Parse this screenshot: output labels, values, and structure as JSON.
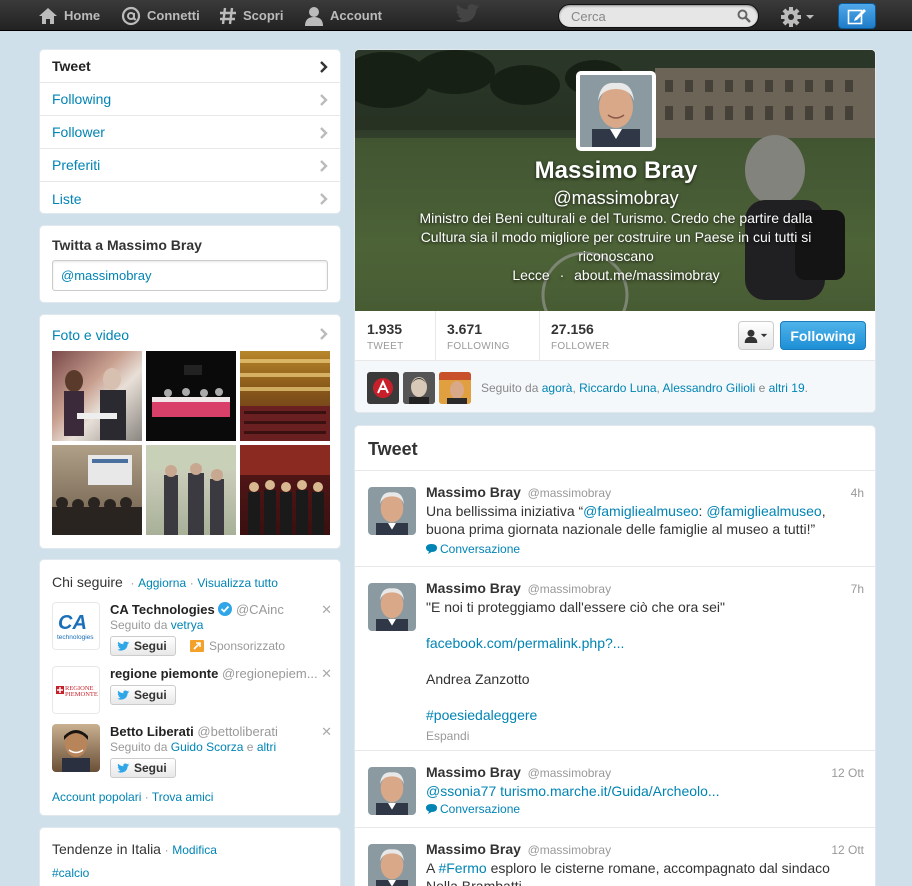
{
  "nav": {
    "home": "Home",
    "connect": "Connetti",
    "discover": "Scopri",
    "account": "Account",
    "search_placeholder": "Cerca"
  },
  "menu": {
    "items": [
      {
        "label": "Tweet"
      },
      {
        "label": "Following"
      },
      {
        "label": "Follower"
      },
      {
        "label": "Preferiti"
      },
      {
        "label": "Liste"
      }
    ]
  },
  "tweet_to": {
    "title": "Twitta a Massimo Bray",
    "value": "@massimobray"
  },
  "photos": {
    "title": "Foto e video"
  },
  "who_to_follow": {
    "title": "Chi seguire",
    "sep1": "·",
    "refresh": "Aggiorna",
    "sep2": "·",
    "view_all": "Visualizza tutto",
    "follow_label": "Segui",
    "users": [
      {
        "name": "CA Technologies",
        "handle": "@CAinc",
        "sub_prefix": "Seguito da",
        "sub_link": "vetrya",
        "sub_suffix": "",
        "promoted": "Sponsorizzato"
      },
      {
        "name": "regione piemonte",
        "handle": "@regionepiem...",
        "sub_prefix": "",
        "sub_link": "",
        "sub_suffix": "",
        "promoted": ""
      },
      {
        "name": "Betto Liberati",
        "handle": "@bettoliberati",
        "sub_prefix": "Seguito da",
        "sub_link": "Guido Scorza",
        "sub_mid": "e",
        "sub_suffix": "altri",
        "promoted": ""
      }
    ],
    "ca_logo_text": "technologies",
    "rp_logo_text1": "REGIONE",
    "rp_logo_text2": "PIEMONTE",
    "popular": "Account popolari",
    "sep3": "·",
    "find_friends": "Trova amici"
  },
  "trends": {
    "title": "Tendenze in Italia",
    "sep": "·",
    "change": "Modifica",
    "items": [
      "#calcio"
    ]
  },
  "profile": {
    "name": "Massimo Bray",
    "handle": "@massimobray",
    "bio": "Ministro dei Beni culturali e del Turismo. Credo che partire dalla Cultura sia il modo migliore per costruire un Paese in cui tutti si riconoscano",
    "location": "Lecce",
    "meta_sep": "·",
    "url": "about.me/massimobray",
    "stats": [
      {
        "value": "1.935",
        "label": "TWEET"
      },
      {
        "value": "3.671",
        "label": "FOLLOWING"
      },
      {
        "value": "27.156",
        "label": "FOLLOWER"
      }
    ],
    "following_label": "Following",
    "followed_by": {
      "prefix": "Seguito da",
      "user1": "agorà",
      "comma1": ",",
      "user2": "Riccardo Luna",
      "comma2": ",",
      "user3": "Alessandro Gilioli",
      "and": "e",
      "others": "altri 19",
      "period": "."
    }
  },
  "stream": {
    "title": "Tweet",
    "conversation": "Conversazione",
    "expand": "Espandi",
    "tweets": [
      {
        "name": "Massimo Bray",
        "handle": "@massimobray",
        "time": "4h",
        "t1": "Una bellissima iniziativa “",
        "l1": "@famigliealmuseo",
        "t2": ": ",
        "l2": "@famigliealmuseo",
        "t3": ", buona prima giornata nazionale delle famiglie al museo a tutti!”"
      },
      {
        "name": "Massimo Bray",
        "handle": "@massimobray",
        "time": "7h",
        "line1": "\"E noi ti proteggiamo dall'essere ciò che ora sei\"",
        "link": "facebook.com/permalink.php?...",
        "line2": "Andrea Zanzotto",
        "hashtag": "#poesiedaleggere"
      },
      {
        "name": "Massimo Bray",
        "handle": "@massimobray",
        "time": "12 Ott",
        "l1": "@ssonia77",
        "l2": "turismo.marche.it/Guida/Archeolo..."
      },
      {
        "name": "Massimo Bray",
        "handle": "@massimobray",
        "time": "12 Ott",
        "t1": "A ",
        "l1": "#Fermo",
        "t2": " esploro le cisterne romane, accompagnato dal sindaco Nella Brambatti"
      }
    ]
  },
  "colors": {
    "link": "#0084b4",
    "follow_blue": "#1d8fd6",
    "topbar": "#2b2b2b"
  }
}
